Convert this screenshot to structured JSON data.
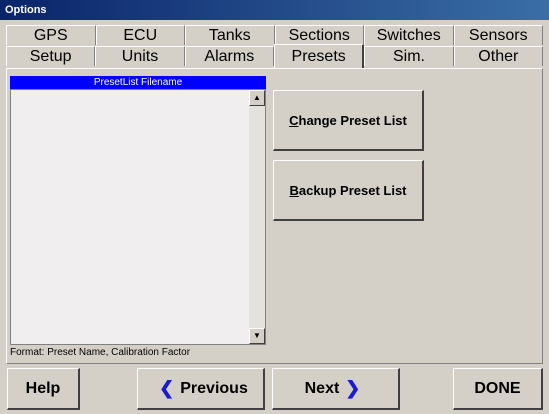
{
  "window": {
    "title": "Options"
  },
  "tabs": {
    "row1": [
      {
        "label": "GPS"
      },
      {
        "label": "ECU"
      },
      {
        "label": "Tanks"
      },
      {
        "label": "Sections"
      },
      {
        "label": "Switches"
      },
      {
        "label": "Sensors"
      }
    ],
    "row2": [
      {
        "label": "Setup"
      },
      {
        "label": "Units"
      },
      {
        "label": "Alarms"
      },
      {
        "label": "Presets"
      },
      {
        "label": "Sim."
      },
      {
        "label": "Other"
      }
    ],
    "active": "Presets"
  },
  "presets": {
    "list_header": "PresetList Filename",
    "list_items": [],
    "format_note": "Format: Preset Name, Calibration Factor",
    "change_button": {
      "accel": "C",
      "rest": "hange Preset List"
    },
    "backup_button": {
      "accel": "B",
      "rest": "ackup Preset List"
    }
  },
  "footer": {
    "help": "Help",
    "previous": "Previous",
    "next": "Next",
    "done": "DONE"
  },
  "icons": {
    "previous_arrow": "arrow-left-icon",
    "next_arrow": "arrow-right-icon",
    "scroll_up": "scroll-up-icon",
    "scroll_down": "scroll-down-icon"
  },
  "colors": {
    "title_bar": "#0a246a",
    "list_header_bg": "#0000ff",
    "arrow": "#1a1ad6",
    "face": "#d4d0c8"
  }
}
